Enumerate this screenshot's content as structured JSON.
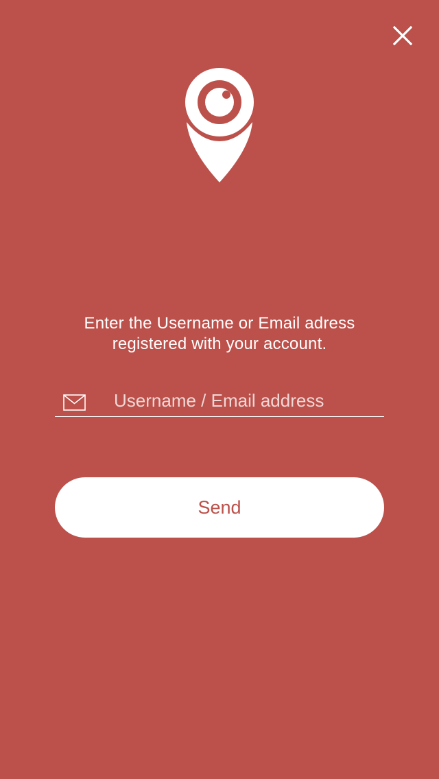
{
  "colors": {
    "background": "#BC504A",
    "foreground": "#FFFFFF",
    "button_text": "#BC504A"
  },
  "header": {
    "close_icon": "close-icon"
  },
  "logo": {
    "icon": "map-pin-eye-icon"
  },
  "instructions": {
    "line1": "Enter the Username or  Email adress",
    "line2": "registered with your account."
  },
  "form": {
    "field_icon": "envelope-icon",
    "username_placeholder": "Username / Email address",
    "username_value": "",
    "send_label": "Send"
  }
}
